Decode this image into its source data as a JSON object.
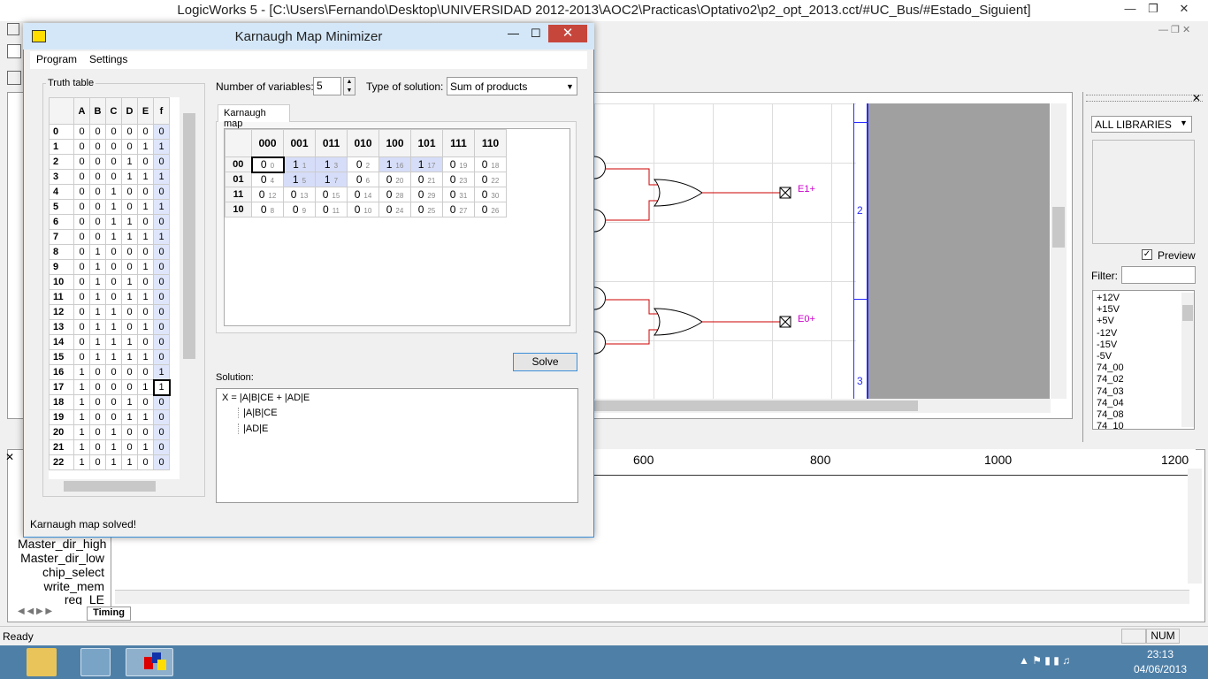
{
  "app": {
    "title": "LogicWorks 5 - [C:\\Users\\Fernando\\Desktop\\UNIVERSIDAD 2012-2013\\AOC2\\Practicas\\Optativo2\\p2_opt_2013.cct/#UC_Bus/#Estado_Siguient]"
  },
  "kmap": {
    "title": "Karnaugh Map Minimizer",
    "menu": [
      "Program",
      "Settings"
    ],
    "truth_table_label": "Truth table",
    "num_vars_label": "Number of variables:",
    "num_vars_value": "5",
    "solution_type_label": "Type of solution:",
    "solution_type_value": "Sum of products",
    "tab_label": "Karnaugh map",
    "truth_headers": [
      "A",
      "B",
      "C",
      "D",
      "E",
      "f"
    ],
    "truth_rows": [
      [
        "0",
        "0",
        "0",
        "0",
        "0",
        "0",
        "0"
      ],
      [
        "1",
        "0",
        "0",
        "0",
        "0",
        "1",
        "1"
      ],
      [
        "2",
        "0",
        "0",
        "0",
        "1",
        "0",
        "0"
      ],
      [
        "3",
        "0",
        "0",
        "0",
        "1",
        "1",
        "1"
      ],
      [
        "4",
        "0",
        "0",
        "1",
        "0",
        "0",
        "0"
      ],
      [
        "5",
        "0",
        "0",
        "1",
        "0",
        "1",
        "1"
      ],
      [
        "6",
        "0",
        "0",
        "1",
        "1",
        "0",
        "0"
      ],
      [
        "7",
        "0",
        "0",
        "1",
        "1",
        "1",
        "1"
      ],
      [
        "8",
        "0",
        "1",
        "0",
        "0",
        "0",
        "0"
      ],
      [
        "9",
        "0",
        "1",
        "0",
        "0",
        "1",
        "0"
      ],
      [
        "10",
        "0",
        "1",
        "0",
        "1",
        "0",
        "0"
      ],
      [
        "11",
        "0",
        "1",
        "0",
        "1",
        "1",
        "0"
      ],
      [
        "12",
        "0",
        "1",
        "1",
        "0",
        "0",
        "0"
      ],
      [
        "13",
        "0",
        "1",
        "1",
        "0",
        "1",
        "0"
      ],
      [
        "14",
        "0",
        "1",
        "1",
        "1",
        "0",
        "0"
      ],
      [
        "15",
        "0",
        "1",
        "1",
        "1",
        "1",
        "0"
      ],
      [
        "16",
        "1",
        "0",
        "0",
        "0",
        "0",
        "1"
      ],
      [
        "17",
        "1",
        "0",
        "0",
        "0",
        "1",
        "1"
      ],
      [
        "18",
        "1",
        "0",
        "0",
        "1",
        "0",
        "0"
      ],
      [
        "19",
        "1",
        "0",
        "0",
        "1",
        "1",
        "0"
      ],
      [
        "20",
        "1",
        "0",
        "1",
        "0",
        "0",
        "0"
      ],
      [
        "21",
        "1",
        "0",
        "1",
        "0",
        "1",
        "0"
      ],
      [
        "22",
        "1",
        "0",
        "1",
        "1",
        "0",
        "0"
      ]
    ],
    "kmap_cols": [
      "000",
      "001",
      "011",
      "010",
      "100",
      "101",
      "111",
      "110"
    ],
    "kmap_rows": [
      {
        "label": "00",
        "cells": [
          [
            "0",
            "0"
          ],
          [
            "1",
            "1"
          ],
          [
            "1",
            "3"
          ],
          [
            "0",
            "2"
          ],
          [
            "1",
            "16"
          ],
          [
            "1",
            "17"
          ],
          [
            "0",
            "19"
          ],
          [
            "0",
            "18"
          ]
        ]
      },
      {
        "label": "01",
        "cells": [
          [
            "0",
            "4"
          ],
          [
            "1",
            "5"
          ],
          [
            "1",
            "7"
          ],
          [
            "0",
            "6"
          ],
          [
            "0",
            "20"
          ],
          [
            "0",
            "21"
          ],
          [
            "0",
            "23"
          ],
          [
            "0",
            "22"
          ]
        ]
      },
      {
        "label": "11",
        "cells": [
          [
            "0",
            "12"
          ],
          [
            "0",
            "13"
          ],
          [
            "0",
            "15"
          ],
          [
            "0",
            "14"
          ],
          [
            "0",
            "28"
          ],
          [
            "0",
            "29"
          ],
          [
            "0",
            "31"
          ],
          [
            "0",
            "30"
          ]
        ]
      },
      {
        "label": "10",
        "cells": [
          [
            "0",
            "8"
          ],
          [
            "0",
            "9"
          ],
          [
            "0",
            "11"
          ],
          [
            "0",
            "10"
          ],
          [
            "0",
            "24"
          ],
          [
            "0",
            "25"
          ],
          [
            "0",
            "27"
          ],
          [
            "0",
            "26"
          ]
        ]
      }
    ],
    "solve_label": "Solve",
    "solution_label": "Solution:",
    "solution_main": "X = |A|B|CE + |AD|E",
    "solution_terms": [
      "|A|B|CE",
      "|AD|E"
    ],
    "status": "Karnaugh map solved!"
  },
  "schematic": {
    "labels": [
      "E1+",
      "E0+"
    ],
    "bus_numbers": [
      "2",
      "3"
    ]
  },
  "library": {
    "selected": "ALL LIBRARIES",
    "preview_label": "Preview",
    "filter_label": "Filter:",
    "items": [
      "+12V",
      "+15V",
      "+5V",
      "-12V",
      "-15V",
      "-5V",
      "74_00",
      "74_02",
      "74_03",
      "74_04",
      "74_08",
      "74_10"
    ]
  },
  "timing": {
    "ruler": [
      "600",
      "800",
      "1000",
      "1200"
    ],
    "signals": [
      "Master_dir_high",
      "Master_dir_low",
      "chip_select",
      "write_mem",
      "reg_LE"
    ],
    "tab": "Timing"
  },
  "status": {
    "text": "Ready",
    "num": "NUM"
  },
  "taskbar": {
    "time": "23:13",
    "date": "04/06/2013"
  }
}
